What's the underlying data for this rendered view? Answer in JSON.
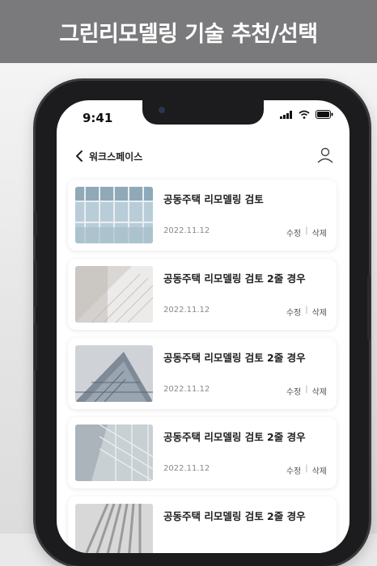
{
  "banner": {
    "title": "그린리모델링 기술 추천/선택"
  },
  "status_bar": {
    "time": "9:41"
  },
  "nav": {
    "title": "워크스페이스"
  },
  "items": [
    {
      "title": "공동주택 리모델링 검토",
      "date": "2022.11.12",
      "edit_label": "수정",
      "delete_label": "삭제"
    },
    {
      "title": "공동주택 리모델링 검토 2줄 경우",
      "date": "2022.11.12",
      "edit_label": "수정",
      "delete_label": "삭제"
    },
    {
      "title": "공동주택 리모델링 검토 2줄 경우",
      "date": "2022.11.12",
      "edit_label": "수정",
      "delete_label": "삭제"
    },
    {
      "title": "공동주택 리모델링 검토 2줄 경우",
      "date": "2022.11.12",
      "edit_label": "수정",
      "delete_label": "삭제"
    },
    {
      "title": "공동주택 리모델링 검토 2줄 경우"
    }
  ],
  "icons": {
    "back": "chevron-left-icon",
    "profile": "user-icon",
    "signal": "signal-icon",
    "wifi": "wifi-icon",
    "battery": "battery-icon"
  }
}
